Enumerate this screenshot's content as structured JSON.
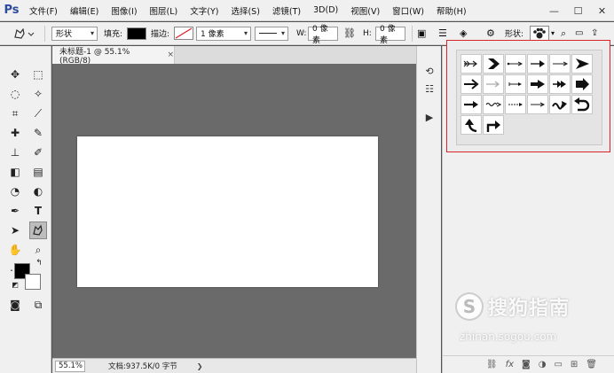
{
  "app": {
    "logo": "Ps"
  },
  "menu": [
    "文件(F)",
    "编辑(E)",
    "图像(I)",
    "图层(L)",
    "文字(Y)",
    "选择(S)",
    "滤镜(T)",
    "3D(D)",
    "视图(V)",
    "窗口(W)",
    "帮助(H)"
  ],
  "window_controls": {
    "minimize": "—",
    "maximize": "☐",
    "close": "✕"
  },
  "options": {
    "mode_value": "形状",
    "fill_label": "填充:",
    "fill_color": "#000000",
    "stroke_label": "描边:",
    "stroke_width_value": "1 像素",
    "w_label": "W:",
    "w_value": "0 像素",
    "h_label": "H:",
    "h_value": "0 像素",
    "shape_label": "形状:"
  },
  "document": {
    "tab_title": "未标题-1 @ 55.1%(RGB/8)",
    "tab_close": "×",
    "zoom": "55.1%",
    "info": "文档:937.5K/0 字节",
    "canvas_color": "#ffffff"
  },
  "colors": {
    "foreground": "#000000",
    "background": "#ffffff",
    "picker_border": "#d9232a"
  },
  "shapes": [
    "arrow-feathered-icon",
    "arrow-chevron-icon",
    "arrow-thin-dots-icon",
    "arrow-long-icon",
    "arrow-thin-icon",
    "arrow-triangle-icon",
    "arrow-bold-line-icon",
    "arrow-light-icon",
    "arrow-small-icon",
    "arrow-solid-icon",
    "arrow-double-head-icon",
    "arrow-block-icon",
    "arrow-short-bold-icon",
    "arrow-wave-icon",
    "arrow-dotted-icon",
    "arrow-simple-icon",
    "arrow-squiggle-icon",
    "arrow-curved-back-icon",
    "arrow-curve-up-left-icon",
    "arrow-turn-right-icon"
  ],
  "watermark": {
    "logo_letter": "S",
    "name": "搜狗指南",
    "url": "zhinan.sogou.com"
  }
}
